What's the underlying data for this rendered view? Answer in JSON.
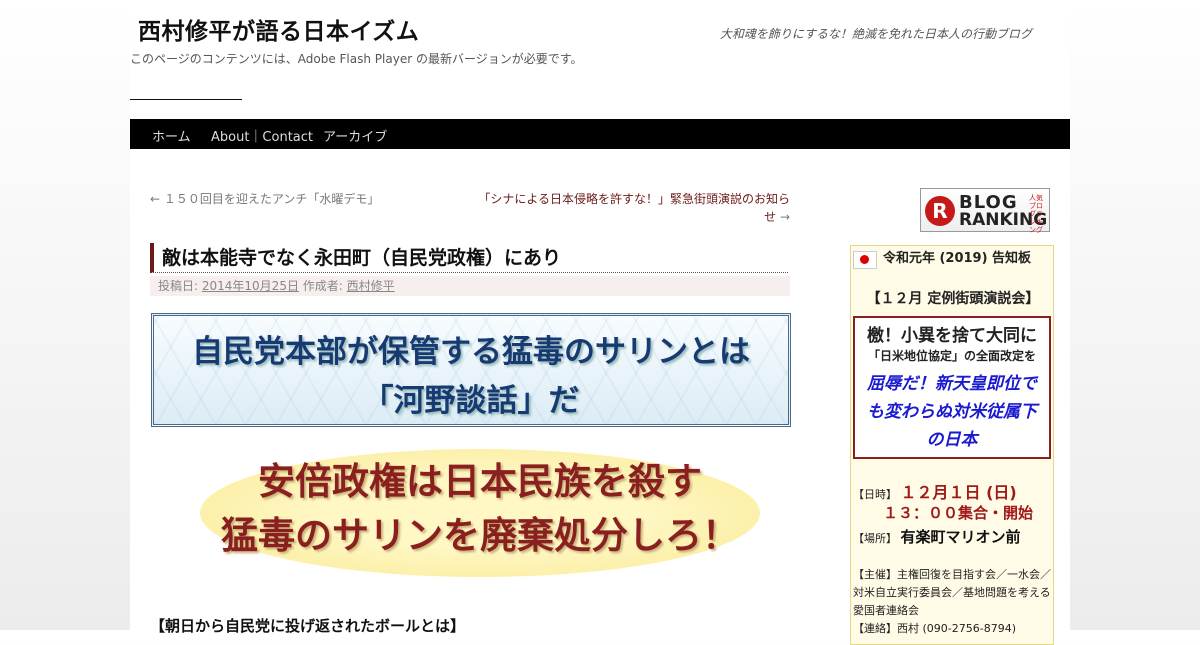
{
  "site": {
    "title": "西村修平が語る日本イズム",
    "description": "大和魂を飾りにするな！絶滅を免れた日本人の行動ブログ",
    "flash_note": "このページのコンテンツには、Adobe Flash Player の最新バージョンが必要です。"
  },
  "nav": {
    "items": [
      {
        "label": "ホーム"
      },
      {
        "label": "About｜Contact"
      },
      {
        "label": "アーカイブ"
      }
    ]
  },
  "post_nav": {
    "prev": "← １５０回目を迎えたアンチ「水曜デモ」",
    "next_text": "「シナによる日本侵略を許すな！」緊急街頭演説のお知らせ",
    "next_arrow": "→"
  },
  "entry": {
    "title": "敵は本能寺でなく永田町（自民党政権）にあり",
    "meta": {
      "posted_label": "投稿日:",
      "date": "2014年10月25日",
      "author_label": "作成者:",
      "author": "西村修平"
    },
    "banner1": {
      "line1": "自民党本部が保管する猛毒のサリンとは",
      "line2": "「河野談話」だ"
    },
    "banner2": {
      "line1": "安倍政権は日本民族を殺す",
      "line2": "猛毒のサリンを廃棄処分しろ！"
    },
    "subheading": "【朝日から自民党に投げ返されたボールとは】"
  },
  "sidebar": {
    "ranking": {
      "letter": "R",
      "blog": "BLOG",
      "ranking": "RANKING",
      "tiny": "人気ブログランキング"
    },
    "notice": {
      "title": "令和元年 (2019) 告知板",
      "subtitle": "【１２月 定例街頭演説会】",
      "theme_line1": "檄！小異を捨て大同に",
      "theme_line2": "「日米地位協定」の全面改定を",
      "theme_line3": "屈辱だ！新天皇即位でも変わらぬ対米従属下の日本",
      "date_label": "【日時】",
      "date_value": "１２月１日 (日)",
      "time_value": "１３：００集合・開始",
      "place_label": "【場所】",
      "place_value": "有楽町マリオン前",
      "organizer": "【主催】主権回復を目指す会／一水会／対米自立実行委員会／基地問題を考える愛国者連絡会",
      "contact": "【連絡】西村 (090-2756-8794)"
    }
  }
}
